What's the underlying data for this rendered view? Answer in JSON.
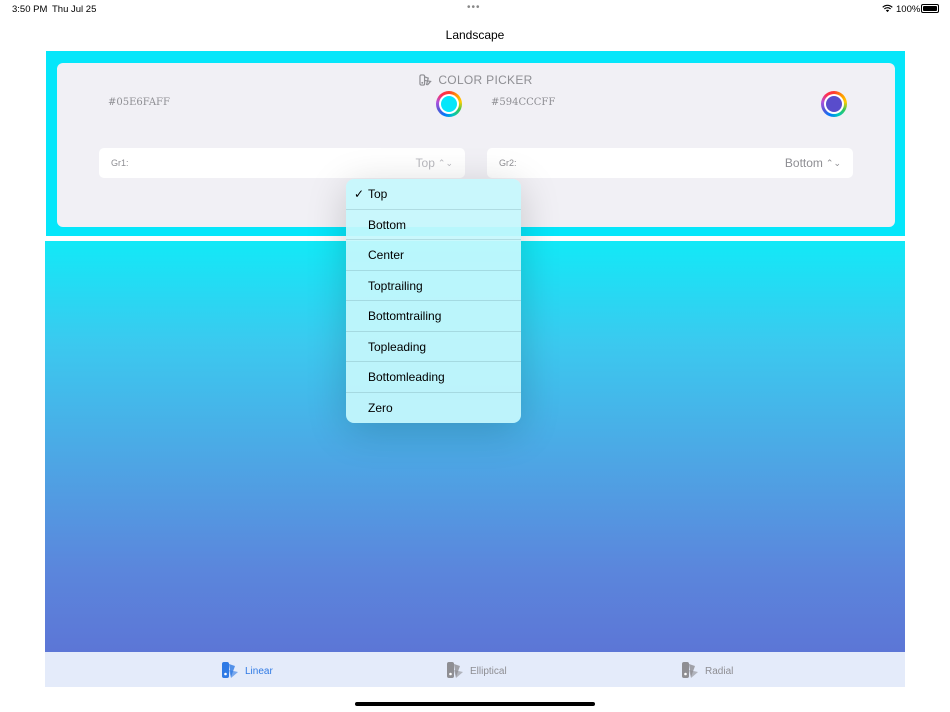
{
  "status_bar": {
    "time": "3:50 PM",
    "date": "Thu Jul 25",
    "battery": "100%"
  },
  "nav": {
    "title": "Landscape"
  },
  "picker": {
    "header": "COLOR PICKER",
    "color1": {
      "hex": "#05E6FAFF",
      "swatch": "#05e6fa"
    },
    "color2": {
      "hex": "#594CCCFF",
      "swatch": "#594ccc"
    },
    "gr1": {
      "label": "Gr1:",
      "value": "Top"
    },
    "gr2": {
      "label": "Gr2:",
      "value": "Bottom"
    }
  },
  "menu": {
    "selected": "Top",
    "check": "✓",
    "items": [
      "Top",
      "Bottom",
      "Center",
      "Toptrailing",
      "Bottomtrailing",
      "Topleading",
      "Bottomleading",
      "Zero"
    ]
  },
  "tabs": [
    {
      "label": "Linear",
      "icon": "swatch-icon",
      "selected": true
    },
    {
      "label": "Elliptical",
      "icon": "swatch-icon",
      "selected": false
    },
    {
      "label": "Radial",
      "icon": "swatch-icon",
      "selected": false
    }
  ],
  "colors": {
    "frame": "#05e6fa",
    "accent": "#2f7ae5",
    "tab_bar": "#e4ebfa"
  }
}
